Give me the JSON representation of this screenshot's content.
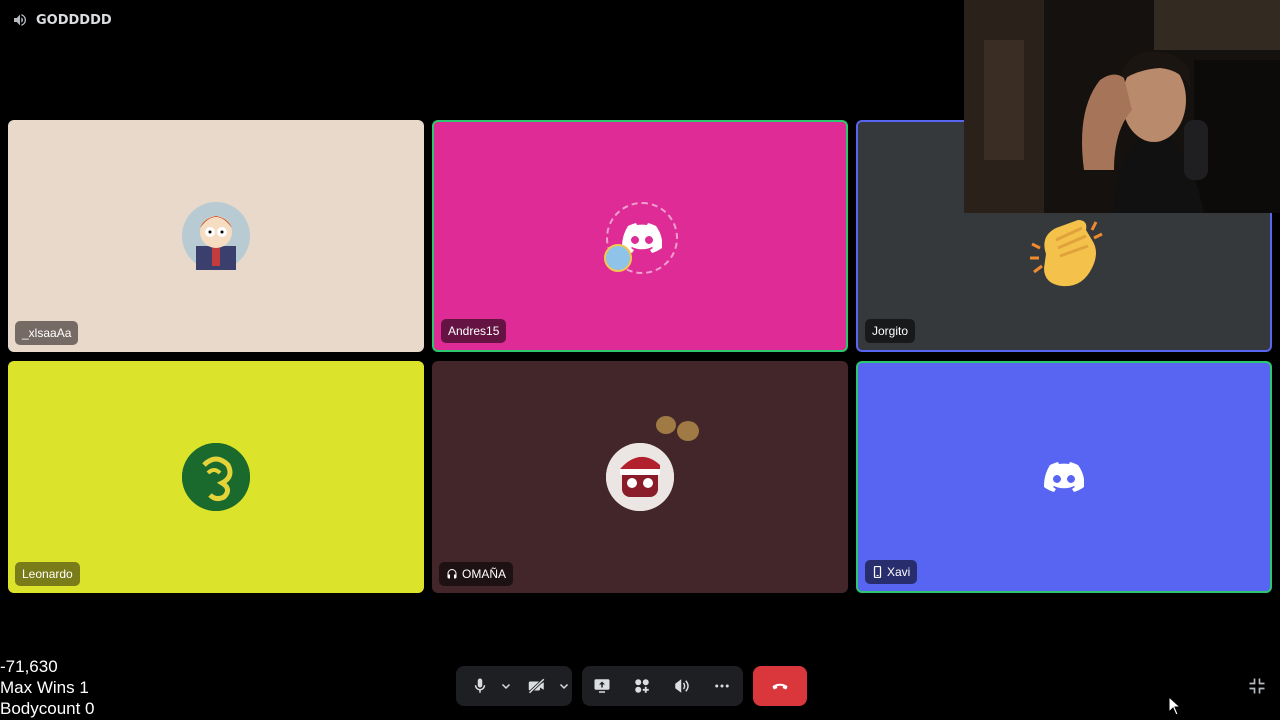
{
  "channel": {
    "name": "GODDDDD",
    "icon": "speaker-icon"
  },
  "participants": [
    {
      "name": "_xlsaaAa",
      "tile_color": "#e8d9cb",
      "avatar": "cartoon-avatar",
      "state": "normal",
      "tag_icon": ""
    },
    {
      "name": "Andres15",
      "tile_color": "#de2b96",
      "avatar": "discord-logo-avatar",
      "state": "speaking",
      "tag_icon": ""
    },
    {
      "name": "Jorgito",
      "tile_color": "#36393b",
      "avatar": "clapping-hands-emoji",
      "state": "active",
      "tag_icon": ""
    },
    {
      "name": "Leonardo",
      "tile_color": "#dbe42a",
      "avatar": "green-emblem-avatar",
      "state": "normal",
      "tag_icon": ""
    },
    {
      "name": "OMAÑA",
      "tile_color": "#43262a",
      "avatar": "santa-hat-avatar",
      "state": "normal",
      "tag_icon": "headset-icon"
    },
    {
      "name": "Xavi",
      "tile_color": "#5865f2",
      "avatar": "discord-logo-avatar",
      "state": "speaking",
      "tag_icon": "mobile-icon"
    }
  ],
  "stats": {
    "line1": "-71,630",
    "line2": "Max Wins 1",
    "line3": "Bodycount 0"
  },
  "controls": {
    "mic": "microphone-icon",
    "mic_menu": "chevron-down-icon",
    "camera": "camera-off-icon",
    "camera_menu": "chevron-down-icon",
    "screen_share": "screen-share-icon",
    "activities": "activities-icon",
    "soundboard": "soundboard-icon",
    "more": "more-icon",
    "disconnect": "hang-up-icon",
    "fullscreen": "exit-fullscreen-icon"
  },
  "colors": {
    "hangup": "#da373c",
    "speaking": "#2dc770",
    "blurple": "#5865f2"
  }
}
